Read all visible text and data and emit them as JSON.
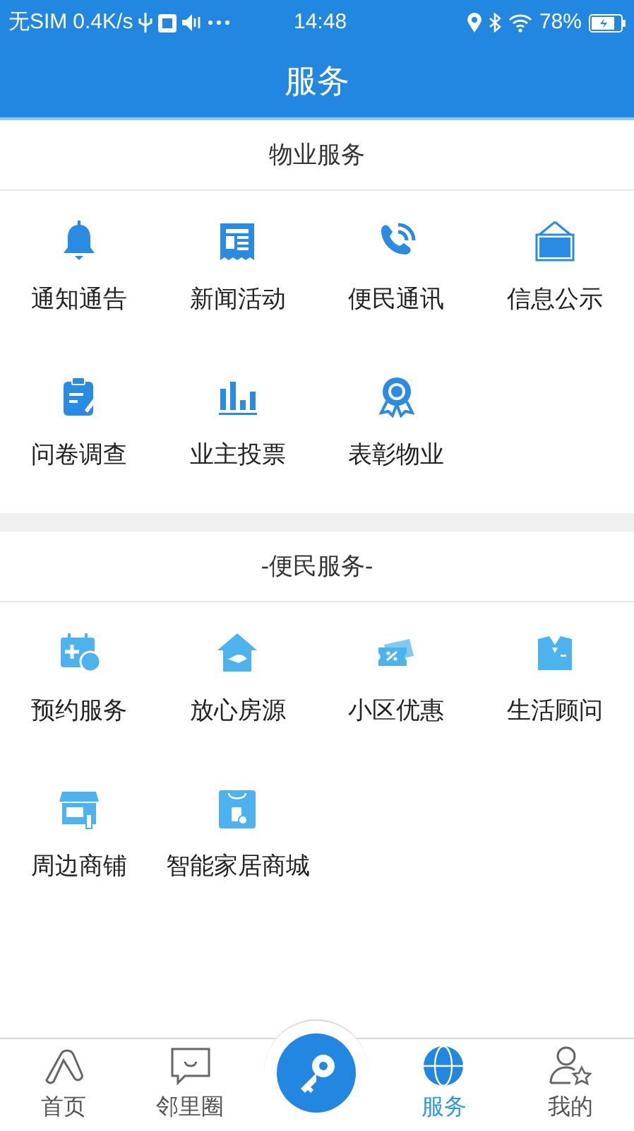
{
  "status_bar": {
    "carrier": "无SIM",
    "speed": "0.4K/s",
    "time": "14:48",
    "battery": "78%"
  },
  "header": {
    "title": "服务"
  },
  "sections": [
    {
      "title": "物业服务",
      "items": [
        {
          "label": "通知通告"
        },
        {
          "label": "新闻活动"
        },
        {
          "label": "便民通讯"
        },
        {
          "label": "信息公示"
        },
        {
          "label": "问卷调查"
        },
        {
          "label": "业主投票"
        },
        {
          "label": "表彰物业"
        }
      ]
    },
    {
      "title": "-便民服务-",
      "items": [
        {
          "label": "预约服务"
        },
        {
          "label": "放心房源"
        },
        {
          "label": "小区优惠"
        },
        {
          "label": "生活顾问"
        },
        {
          "label": "周边商铺"
        },
        {
          "label": "智能家居商城"
        }
      ]
    }
  ],
  "tab_bar": [
    {
      "kind": "tab",
      "label": "首页",
      "selected": false
    },
    {
      "kind": "tab",
      "label": "邻里圈",
      "selected": false
    },
    {
      "kind": "center"
    },
    {
      "kind": "tab",
      "label": "服务",
      "selected": true
    },
    {
      "kind": "tab",
      "label": "我的",
      "selected": false
    }
  ]
}
